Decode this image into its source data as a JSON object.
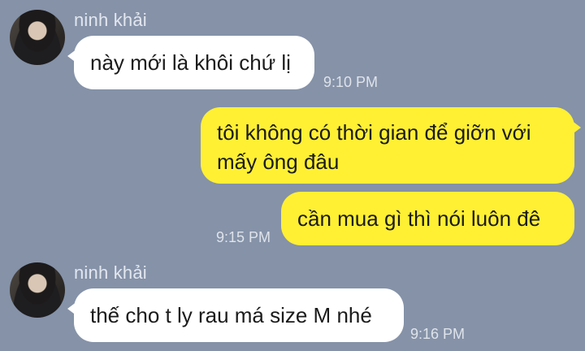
{
  "colors": {
    "background": "#8592a8",
    "incoming_bubble": "#ffffff",
    "outgoing_bubble": "#fff034"
  },
  "messages": [
    {
      "sender": "ninh khải",
      "text": "này mới là khôi chứ lị",
      "time": "9:10 PM"
    },
    {
      "text": "tôi không có thời gian để giỡn với mấy ông đâu"
    },
    {
      "text": "cần mua gì thì nói luôn đê",
      "time": "9:15 PM"
    },
    {
      "sender": "ninh khải",
      "text": "thế cho t ly rau má size M nhé",
      "time": "9:16 PM"
    }
  ]
}
